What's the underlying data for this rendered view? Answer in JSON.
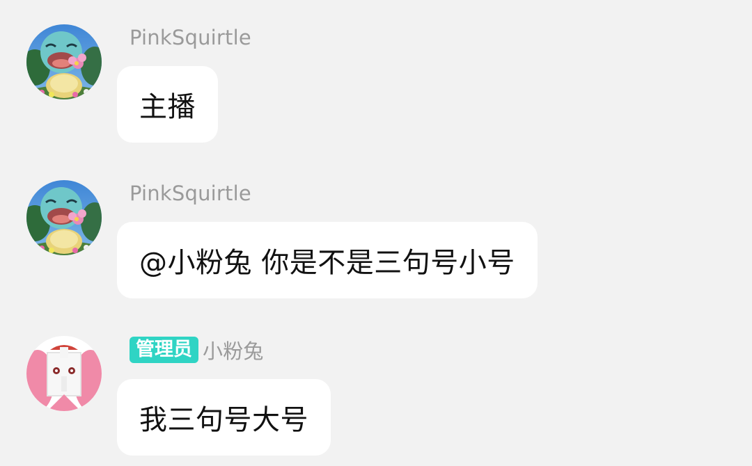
{
  "messages": [
    {
      "username": "PinkSquirtle",
      "text": "主播",
      "avatar_icon": "squirtle-avatar"
    },
    {
      "username": "PinkSquirtle",
      "text": "@小粉兔 你是不是三句号小号",
      "avatar_icon": "squirtle-avatar"
    },
    {
      "badge": "管理员",
      "username": "小粉兔",
      "text": "我三句号大号",
      "avatar_icon": "pink-rabbit-avatar"
    }
  ],
  "colors": {
    "background": "#f2f2f2",
    "bubble": "#ffffff",
    "username": "#9a9a9a",
    "admin_badge": "#2fd4c4",
    "message_text": "#111111"
  }
}
